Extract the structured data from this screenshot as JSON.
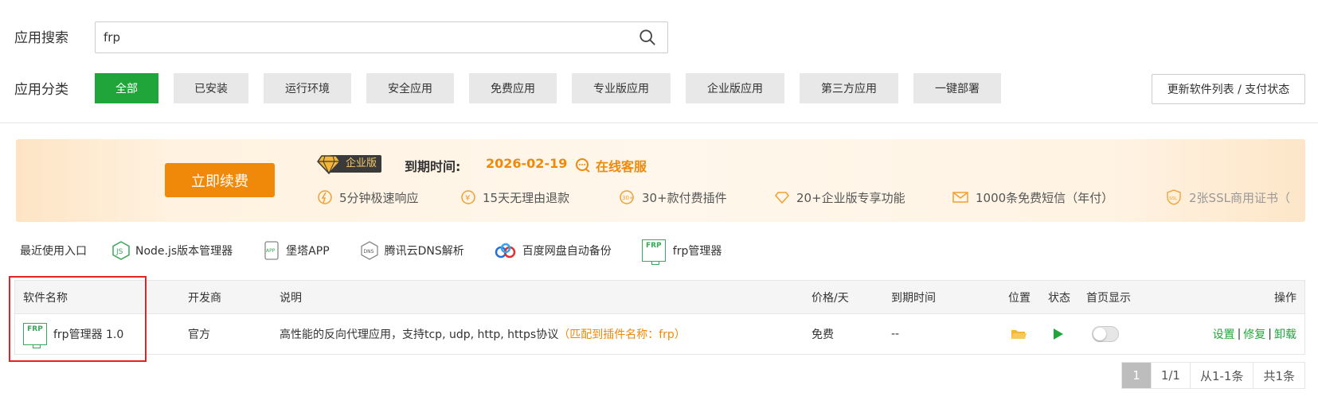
{
  "search": {
    "label": "应用搜索",
    "value": "frp"
  },
  "category": {
    "label": "应用分类",
    "items": [
      "全部",
      "已安装",
      "运行环境",
      "安全应用",
      "免费应用",
      "专业版应用",
      "企业版应用",
      "第三方应用",
      "一键部署"
    ],
    "active_index": 0
  },
  "update_button": "更新软件列表 / 支付状态",
  "banner": {
    "renew_button": "立即续费",
    "edition": "企业版",
    "expire_label": "到期时间:",
    "expire_date": "2026-02-19",
    "online_service": "在线客服",
    "features": [
      "5分钟极速响应",
      "15天无理由退款",
      "30+款付费插件",
      "20+企业版专享功能",
      "1000条免费短信（年付）",
      "2张SSL商用证书（"
    ]
  },
  "recent": {
    "label": "最近使用入口",
    "items": [
      "Node.js版本管理器",
      "堡塔APP",
      "腾讯云DNS解析",
      "百度网盘自动备份",
      "frp管理器"
    ]
  },
  "table": {
    "headers": {
      "name": "软件名称",
      "developer": "开发商",
      "desc": "说明",
      "price": "价格/天",
      "expire": "到期时间",
      "location": "位置",
      "status": "状态",
      "home": "首页显示",
      "ops": "操作"
    },
    "rows": [
      {
        "name": "frp管理器 1.0",
        "developer": "官方",
        "desc": "高性能的反向代理应用，支持tcp, udp, http, https协议",
        "match": "（匹配到插件名称：frp）",
        "price": "免费",
        "expire": "--",
        "home_display": false,
        "ops": [
          "设置",
          "修复",
          "卸载"
        ]
      }
    ]
  },
  "pager": {
    "current": "1",
    "pages": "1/1",
    "range": "从1-1条",
    "total": "共1条"
  },
  "colors": {
    "accent": "#20a53a",
    "orange": "#f0890a"
  }
}
